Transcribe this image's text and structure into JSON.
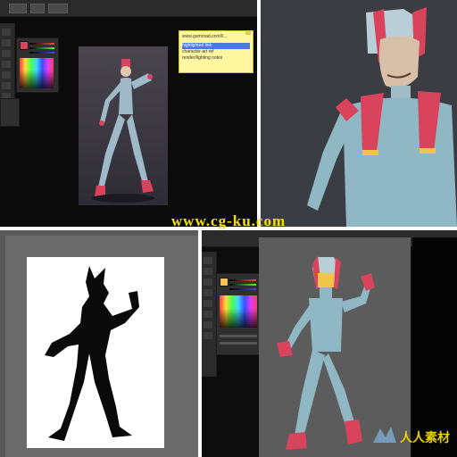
{
  "watermark": "www.cg-ku.com",
  "panel1": {
    "toolbar": {
      "button1": "",
      "button2": "",
      "button3": ""
    },
    "note": {
      "line1": "www.gumroad.com/l/...",
      "line2": "highlighted link",
      "line3": "character-art ref",
      "line4": "render/lighting notes"
    }
  },
  "panel4": {
    "logo_text": "人人素材"
  },
  "colors": {
    "skin": "#8fb8c4",
    "accent": "#d9435b",
    "dark_bg": "#3a3e42",
    "note_yellow": "#fff7a0"
  },
  "icons": [
    "color-spectrum-icon",
    "swatch-icon",
    "tool-icon",
    "logo-icon"
  ]
}
